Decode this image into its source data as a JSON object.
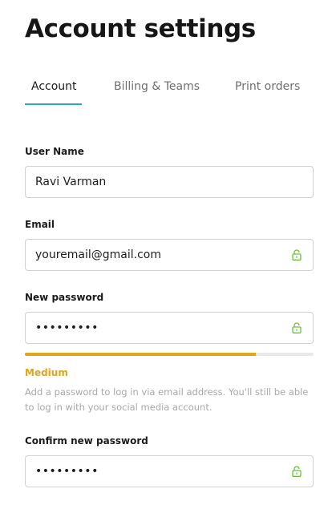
{
  "page": {
    "title": "Account settings"
  },
  "tabs": [
    {
      "label": "Account",
      "active": true
    },
    {
      "label": "Billing & Teams",
      "active": false
    },
    {
      "label": "Print orders",
      "active": false
    }
  ],
  "form": {
    "username": {
      "label": "User Name",
      "value": "Ravi Varman"
    },
    "email": {
      "label": "Email",
      "value": "youremail@gmail.com",
      "icon": "lock-icon"
    },
    "new_password": {
      "label": "New password",
      "value": "•••••••••",
      "icon": "lock-icon"
    },
    "strength": {
      "label": "Medium",
      "fraction": 0.8,
      "color": "#e0a51c"
    },
    "help_text": "Add a password to log in via email address. You'll still be able to log in with your social media account.",
    "confirm_password": {
      "label": "Confirm new password",
      "value": "•••••••••",
      "icon": "lock-icon"
    }
  },
  "colors": {
    "accent": "#2aa7be",
    "lock": "#6bbf3a",
    "warning": "#e0a51c"
  }
}
